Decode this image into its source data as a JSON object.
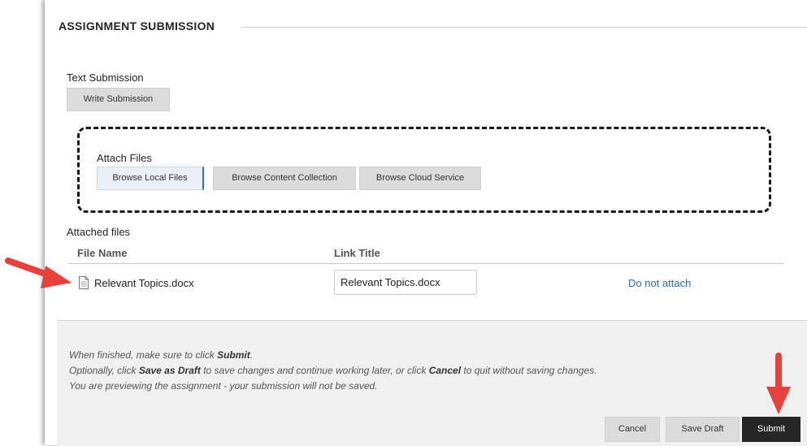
{
  "section": {
    "title": "ASSIGNMENT SUBMISSION"
  },
  "text_submission": {
    "label": "Text Submission",
    "write_button": "Write Submission"
  },
  "attach_files": {
    "label": "Attach Files",
    "buttons": [
      "Browse Local Files",
      "Browse Content Collection",
      "Browse Cloud Service"
    ]
  },
  "attached_files": {
    "label": "Attached files",
    "columns": [
      "File Name",
      "Link Title"
    ],
    "rows": [
      {
        "file_name": "Relevant Topics.docx",
        "link_title": "Relevant Topics.docx",
        "action": "Do not attach",
        "icon": "document-icon"
      }
    ]
  },
  "footer": {
    "line1": {
      "pre": "When finished, make sure to click ",
      "bold": "Submit",
      "post": "."
    },
    "line2": {
      "pre": "Optionally, click ",
      "bold1": "Save as Draft",
      "mid": " to save changes and continue working later, or click ",
      "bold2": "Cancel",
      "post": " to quit without saving changes."
    },
    "line3": "You are previewing the assignment - your submission will not be saved.",
    "buttons": {
      "cancel": "Cancel",
      "save_draft": "Save Draft",
      "submit": "Submit"
    }
  },
  "colors": {
    "link": "#2f6fb5",
    "annotation_arrow": "#e8413c",
    "submit_button": "#262626",
    "footer_bg": "#f0f0f0"
  }
}
